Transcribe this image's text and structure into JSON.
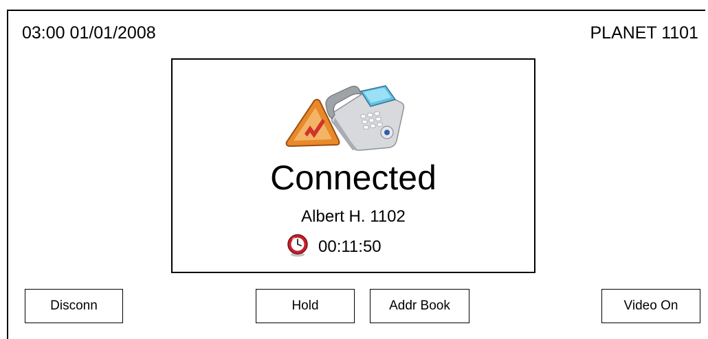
{
  "header": {
    "datetime": "03:00 01/01/2008",
    "device_name": "PLANET 1101"
  },
  "status_panel": {
    "icon": "phone-warning-icon",
    "status": "Connected",
    "caller": "Albert H. 1102",
    "timer_icon": "clock-icon",
    "timer": "00:11:50"
  },
  "buttons": {
    "disconnect": "Disconn",
    "hold": "Hold",
    "address_book": "Addr Book",
    "video": "Video On"
  },
  "colors": {
    "warning_orange": "#E8892A",
    "phone_screen": "#5FC3E8",
    "clock_red": "#C8202A"
  }
}
